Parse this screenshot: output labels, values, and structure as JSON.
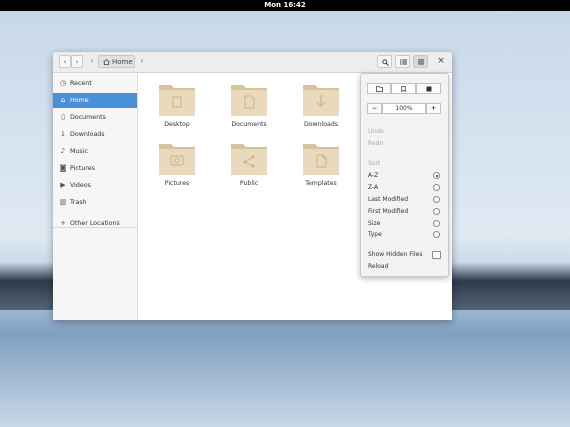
{
  "topbar": {
    "clock": "Mon 16:42"
  },
  "headerbar": {
    "back_glyph": "‹",
    "forward_glyph": "›",
    "path_left_glyph": "‹",
    "path_label": "Home",
    "path_right_glyph": "›",
    "close_glyph": "×"
  },
  "sidebar": {
    "items": [
      {
        "label": "Recent",
        "icon": "recent-icon"
      },
      {
        "label": "Home",
        "icon": "home-icon",
        "active": true
      },
      {
        "label": "Documents",
        "icon": "documents-icon"
      },
      {
        "label": "Downloads",
        "icon": "downloads-icon"
      },
      {
        "label": "Music",
        "icon": "music-icon"
      },
      {
        "label": "Pictures",
        "icon": "pictures-icon"
      },
      {
        "label": "Videos",
        "icon": "videos-icon"
      },
      {
        "label": "Trash",
        "icon": "trash-icon"
      },
      {
        "label": "Other Locations",
        "icon": "plus-icon"
      }
    ]
  },
  "files": [
    {
      "label": "Desktop",
      "icon": "desktop-folder-icon"
    },
    {
      "label": "Documents",
      "icon": "documents-folder-icon"
    },
    {
      "label": "Downloads",
      "icon": "downloads-folder-icon"
    },
    {
      "label": "Pictures",
      "icon": "pictures-folder-icon"
    },
    {
      "label": "Public",
      "icon": "public-folder-icon"
    },
    {
      "label": "Templates",
      "icon": "templates-folder-icon"
    }
  ],
  "menu": {
    "zoom": "100%",
    "zoom_out_glyph": "−",
    "zoom_in_glyph": "+",
    "undo": "Undo",
    "redo": "Redo",
    "sort_heading": "Sort",
    "sort_options": [
      "A-Z",
      "Z-A",
      "Last Modified",
      "First Modified",
      "Size",
      "Type"
    ],
    "sort_selected": "A-Z",
    "show_hidden": "Show Hidden Files",
    "reload": "Reload"
  },
  "colors": {
    "accent": "#4a90d9",
    "folder": "#e9d9bd",
    "folder_dark": "#d8c29c"
  }
}
